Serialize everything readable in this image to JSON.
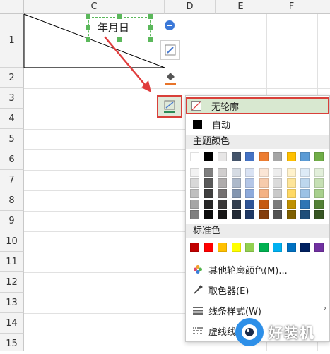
{
  "columns": [
    "C",
    "D",
    "E",
    "F"
  ],
  "rows": [
    "1",
    "2",
    "3",
    "4",
    "5",
    "6",
    "7",
    "8",
    "9",
    "10",
    "11",
    "12",
    "13",
    "14",
    "15"
  ],
  "cell": {
    "text": "年月日"
  },
  "menu": {
    "no_outline": "无轮廓",
    "auto": "自动",
    "theme_colors_title": "主题颜色",
    "standard_colors_title": "标准色",
    "more_colors": "其他轮廓颜色(M)...",
    "eyedropper": "取色器(E)",
    "line_style": "线条样式(W)",
    "dash_style": "虚线线型(S)"
  },
  "theme_colors_top": [
    "#ffffff",
    "#000000",
    "#e7e6e6",
    "#44546a",
    "#4472c4",
    "#ed7d31",
    "#a5a5a5",
    "#ffc000",
    "#5b9bd5",
    "#70ad47"
  ],
  "theme_colors_shades": [
    [
      "#f2f2f2",
      "#7f7f7f",
      "#d0cece",
      "#d6dce4",
      "#d9e2f3",
      "#fbe5d5",
      "#ededed",
      "#fff2cc",
      "#ddebf7",
      "#e2efda"
    ],
    [
      "#d8d8d8",
      "#595959",
      "#aeabab",
      "#adb9ca",
      "#b4c6e7",
      "#f7cbac",
      "#dbdbdb",
      "#fee599",
      "#bdd7ee",
      "#c6e0b4"
    ],
    [
      "#bfbfbf",
      "#3f3f3f",
      "#757171",
      "#8496b0",
      "#8eaadb",
      "#f4b183",
      "#c9c9c9",
      "#ffd965",
      "#9cc2e5",
      "#a8d08d"
    ],
    [
      "#a5a5a5",
      "#262626",
      "#3a3838",
      "#323f4f",
      "#2f5496",
      "#c55a11",
      "#7b7b7b",
      "#bf9000",
      "#2e75b5",
      "#538135"
    ],
    [
      "#7f7f7f",
      "#0c0c0c",
      "#171616",
      "#222a35",
      "#1f3864",
      "#833c0b",
      "#525252",
      "#7f6000",
      "#1f4e79",
      "#375623"
    ]
  ],
  "standard_colors": [
    "#c00000",
    "#ff0000",
    "#ffc000",
    "#ffff00",
    "#92d050",
    "#00b050",
    "#00b0f0",
    "#0070c0",
    "#002060",
    "#7030a0"
  ],
  "watermark": "好装机"
}
